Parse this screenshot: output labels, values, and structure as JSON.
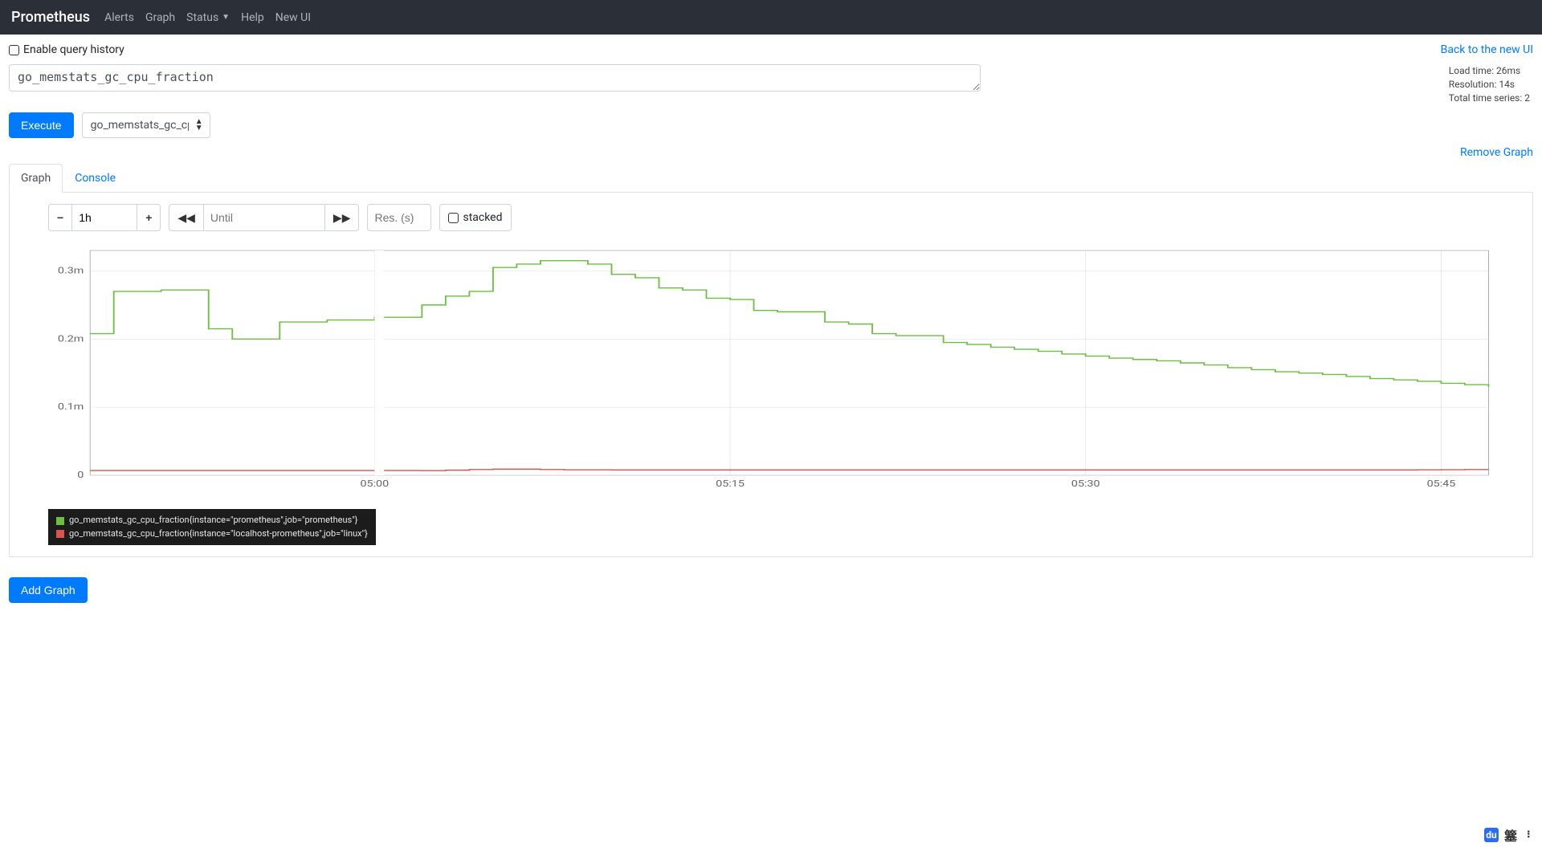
{
  "nav": {
    "brand": "Prometheus",
    "links": [
      "Alerts",
      "Graph",
      "Status",
      "Help",
      "New UI"
    ],
    "status_has_dropdown": true
  },
  "top": {
    "enable_history_label": "Enable query history",
    "back_link": "Back to the new UI"
  },
  "query": {
    "expression": "go_memstats_gc_cpu_fraction",
    "stats": {
      "load_time": "Load time: 26ms",
      "resolution": "Resolution: 14s",
      "total_series": "Total time series: 2"
    }
  },
  "exec": {
    "button": "Execute",
    "metric_select": "go_memstats_gc_cpu_fra"
  },
  "remove_link": "Remove Graph",
  "tabs": {
    "graph": "Graph",
    "console": "Console"
  },
  "controls": {
    "range": "1h",
    "until_placeholder": "Until",
    "res_placeholder": "Res. (s)",
    "stacked_label": "stacked"
  },
  "chart_data": {
    "type": "line",
    "title": "",
    "xlabel": "",
    "ylabel": "",
    "ylim": [
      0,
      0.00033
    ],
    "y_ticks": [
      0,
      0.0001,
      0.0002,
      0.0003
    ],
    "y_tick_labels": [
      "0",
      "0.1m",
      "0.2m",
      "0.3m"
    ],
    "x_tick_labels": [
      "05:00",
      "05:15",
      "05:30",
      "05:45"
    ],
    "x": [
      0,
      1,
      2,
      3,
      4,
      5,
      6,
      7,
      8,
      9,
      10,
      11,
      12,
      13,
      14,
      15,
      16,
      17,
      18,
      19,
      20,
      21,
      22,
      23,
      24,
      25,
      26,
      27,
      28,
      29,
      30,
      31,
      32,
      33,
      34,
      35,
      36,
      37,
      38,
      39,
      40,
      41,
      42,
      43,
      44,
      45,
      46,
      47,
      48,
      49,
      50,
      51,
      52,
      53,
      54,
      55,
      56,
      57,
      58,
      59
    ],
    "series": [
      {
        "name": "go_memstats_gc_cpu_fraction{instance=\"prometheus\",job=\"prometheus\"}",
        "color": "#6cbf3f",
        "values": [
          0.000208,
          0.00027,
          0.00027,
          0.000272,
          0.000272,
          0.000215,
          0.0002,
          0.0002,
          0.000225,
          0.000225,
          0.000228,
          0.000228,
          0.000232,
          0.000232,
          0.00025,
          0.000263,
          0.00027,
          0.000305,
          0.00031,
          0.000315,
          0.000315,
          0.00031,
          0.000295,
          0.00029,
          0.000275,
          0.000272,
          0.00026,
          0.000258,
          0.000242,
          0.00024,
          0.00024,
          0.000225,
          0.000222,
          0.000208,
          0.000205,
          0.000205,
          0.000195,
          0.000192,
          0.000188,
          0.000185,
          0.000182,
          0.000178,
          0.000175,
          0.000172,
          0.00017,
          0.000168,
          0.000165,
          0.000162,
          0.000158,
          0.000155,
          0.000152,
          0.00015,
          0.000148,
          0.000145,
          0.000142,
          0.00014,
          0.000138,
          0.000135,
          0.000133,
          0.00013
        ]
      },
      {
        "name": "go_memstats_gc_cpu_fraction{instance=\"localhost-prometheus\",job=\"linux\"}",
        "color": "#d9534f",
        "values": [
          7e-06,
          7e-06,
          7e-06,
          7e-06,
          7e-06,
          7e-06,
          7e-06,
          7e-06,
          7e-06,
          7e-06,
          7e-06,
          7e-06,
          7e-06,
          7e-06,
          6.8e-06,
          7.5e-06,
          8.5e-06,
          9e-06,
          9e-06,
          8.5e-06,
          8e-06,
          8e-06,
          7.8e-06,
          7.8e-06,
          7.8e-06,
          7.8e-06,
          7.8e-06,
          7.8e-06,
          7.8e-06,
          7.8e-06,
          7.8e-06,
          7.8e-06,
          7.8e-06,
          7.8e-06,
          7.8e-06,
          7.8e-06,
          7.8e-06,
          7.8e-06,
          7.8e-06,
          7.8e-06,
          7.8e-06,
          7.8e-06,
          7.8e-06,
          7.8e-06,
          7.8e-06,
          7.8e-06,
          7.8e-06,
          7.8e-06,
          7.8e-06,
          7.8e-06,
          7.8e-06,
          7.8e-06,
          7.8e-06,
          7.8e-06,
          7.8e-06,
          7.8e-06,
          8e-06,
          8.2e-06,
          8.5e-06,
          8.5e-06
        ]
      }
    ]
  },
  "legend_items": [
    {
      "color": "#6cbf3f",
      "label": "go_memstats_gc_cpu_fraction{instance=\"prometheus\",job=\"prometheus\"}"
    },
    {
      "color": "#d9534f",
      "label": "go_memstats_gc_cpu_fraction{instance=\"localhost-prometheus\",job=\"linux\"}"
    }
  ],
  "add_graph": "Add Graph"
}
